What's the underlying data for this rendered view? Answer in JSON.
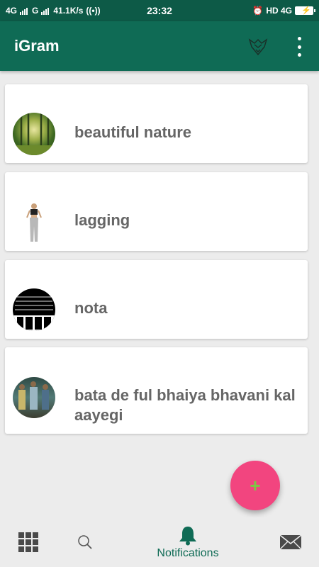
{
  "status_bar": {
    "left": "4G",
    "sim2": "G",
    "speed": "41.1K/s",
    "time": "23:32",
    "right": "HD 4G"
  },
  "app_bar": {
    "title": "iGram"
  },
  "posts": [
    {
      "title": "beautiful nature"
    },
    {
      "title": "lagging"
    },
    {
      "title": "nota"
    },
    {
      "title": "bata de ful bhaiya bhavani kal aayegi"
    }
  ],
  "fab": {
    "label": "+"
  },
  "bottom_nav": {
    "notifications_label": "Notifications"
  },
  "colors": {
    "primary": "#0f6b55",
    "accent": "#f2457f",
    "background": "#ececec"
  }
}
